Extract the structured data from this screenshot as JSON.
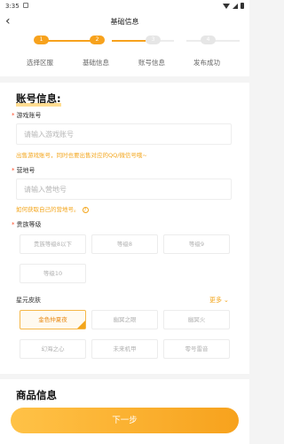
{
  "status_bar": {
    "time": "3:35"
  },
  "header": {
    "title": "基础信息"
  },
  "steps": [
    {
      "num": "1",
      "label": "选择区服",
      "active": true
    },
    {
      "num": "2",
      "label": "基础信息",
      "active": true
    },
    {
      "num": "3",
      "label": "账号信息",
      "active": false
    },
    {
      "num": "4",
      "label": "发布成功",
      "active": false
    }
  ],
  "account": {
    "section_title": "账号信息:",
    "game_account_label": "游戏账号",
    "game_account_placeholder": "请输入游戏账号",
    "game_account_hint": "出售游戏账号，同时也要出售对应的QQ/微信号哦~",
    "camp_label": "营地号",
    "camp_placeholder": "请输入营地号",
    "camp_hint": "如何获取自己的营地号。",
    "noble_label": "贵族等级",
    "noble_levels": [
      "贵族等级8以下",
      "等级8",
      "等级9",
      "等级10"
    ],
    "skin_label": "星元皮肤",
    "more_label": "更多",
    "skins": [
      "金色仲夏夜",
      "幽冥之眼",
      "幽冥火",
      "幻海之心",
      "未来机甲",
      "零号雷音"
    ]
  },
  "next_section_title": "商品信息",
  "bottom_button": "下一步",
  "colors": {
    "accent": "#f7a21d",
    "hint": "#f3a51b"
  }
}
